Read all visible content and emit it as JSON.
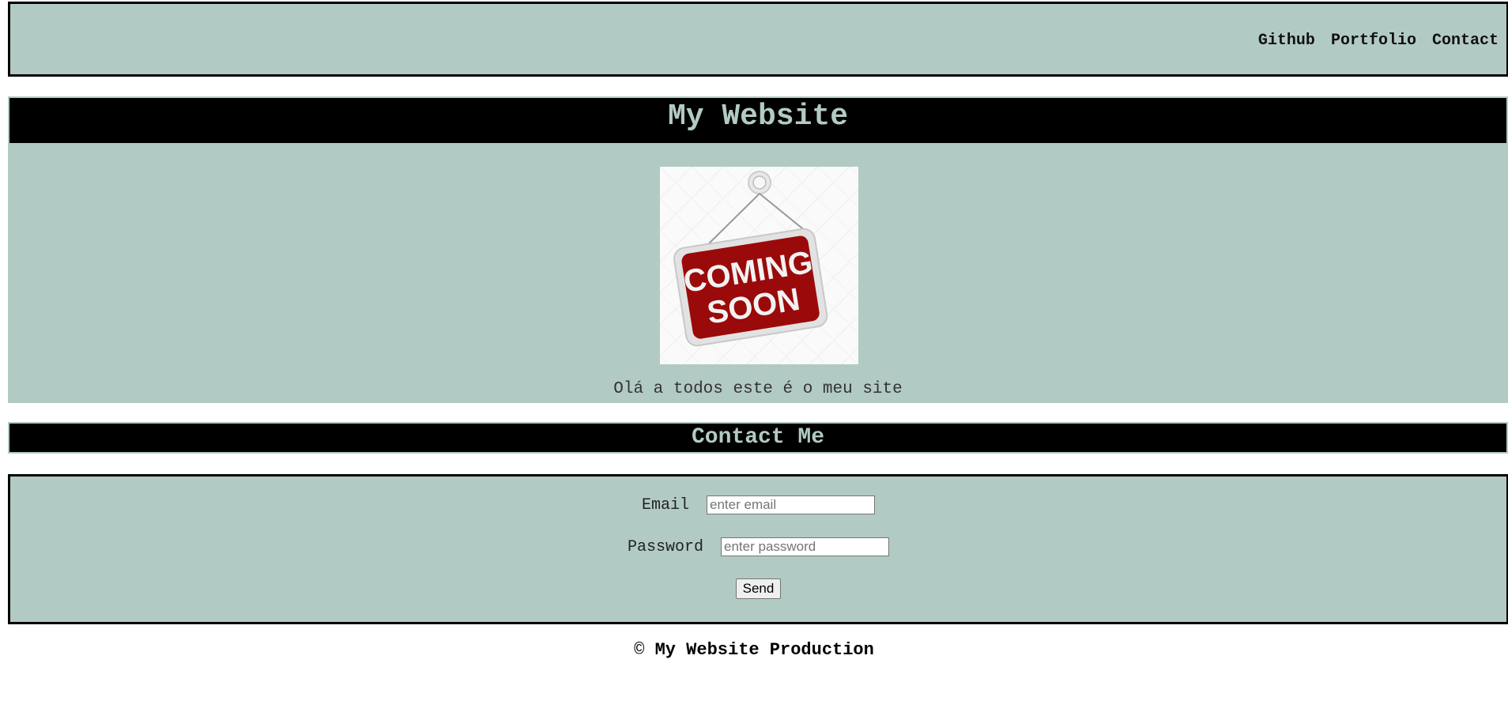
{
  "nav": {
    "links": [
      "Github",
      "Portfolio",
      "Contact"
    ]
  },
  "hero": {
    "title": "My Website",
    "image_alt_text_line1": "COMING",
    "image_alt_text_line2": "SOON",
    "text": "Olá a todos este é o meu site"
  },
  "contact": {
    "title": "Contact Me",
    "email_label": "Email",
    "email_placeholder": "enter email",
    "password_label": "Password",
    "password_placeholder": "enter password",
    "send_label": "Send"
  },
  "footer": {
    "copyright_symbol": "©",
    "text": "My Website Production"
  },
  "colors": {
    "panel": "#b2cac4",
    "title_bar": "#000000",
    "sign_red": "#9b0a0a"
  }
}
